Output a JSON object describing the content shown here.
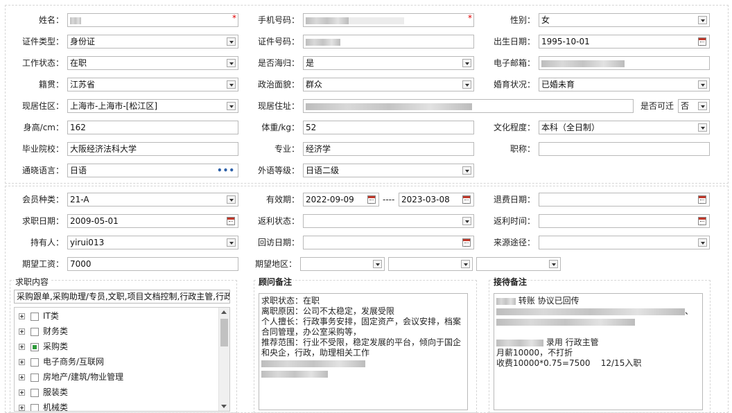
{
  "basic": {
    "name_label": "姓名：",
    "phone_label": "手机号码：",
    "gender_label": "性别：",
    "gender_value": "女",
    "id_type_label": "证件类型：",
    "id_type_value": "身份证",
    "id_no_label": "证件号码：",
    "birth_label": "出生日期：",
    "birth_value": "1995-10-01",
    "work_status_label": "工作状态：",
    "work_status_value": "在职",
    "returnee_label": "是否海归：",
    "returnee_value": "是",
    "email_label": "电子邮箱：",
    "native_label": "籍贯：",
    "native_value": "江苏省",
    "political_label": "政治面貌：",
    "political_value": "群众",
    "marital_label": "婚育状况：",
    "marital_value": "已婚未育",
    "area_label": "现居住区：",
    "area_value": "上海市-上海市-[松江区]",
    "address_label": "现居住址：",
    "relocate_label": "是否可迁",
    "relocate_value": "否",
    "height_label": "身高/cm：",
    "height_value": "162",
    "weight_label": "体重/kg：",
    "weight_value": "52",
    "education_label": "文化程度：",
    "education_value": "本科（全日制）",
    "school_label": "毕业院校：",
    "school_value": "大阪经济法科大学",
    "major_label": "专业：",
    "major_value": "经济学",
    "title_label": "职称：",
    "language_label": "通晓语言：",
    "language_value": "日语",
    "language_more": "•••",
    "lang_level_label": "外语等级：",
    "lang_level_value": "日语二级",
    "required_mark": "*"
  },
  "member": {
    "type_label": "会员种类：",
    "type_value": "21-A",
    "valid_label": "有效期：",
    "valid_from": "2022-09-09",
    "valid_sep": "----",
    "valid_to": "2023-03-08",
    "refund_label": "退费日期：",
    "apply_label": "求职日期：",
    "apply_value": "2009-05-01",
    "rebate_status_label": "返利状态：",
    "rebate_time_label": "返利时间：",
    "holder_label": "持有人：",
    "holder_value": "yirui013",
    "visit_label": "回访日期：",
    "source_label": "来源途径：",
    "salary_label": "期望工资：",
    "salary_value": "7000",
    "region_label": "期望地区："
  },
  "job_content": {
    "title": "求职内容",
    "summary": "采购跟单,采购助理/专员,文职,项目文档控制,行政主管,行政",
    "tree": [
      "IT类",
      "财务类",
      "采购类",
      "电子商务/互联网",
      "房地产/建筑/物业管理",
      "服装类",
      "机械类"
    ]
  },
  "consultant": {
    "title": "顾问备注",
    "lines": [
      "求职状态：在职",
      "离职原因：公司不太稳定，发展受限",
      "个人擅长：行政事务安排，固定资产，会议安排，档案",
      "合同管理，办公室采购等，",
      "推荐范围：行业不受限，稳定发展的平台，倾向于国企",
      "和央企，行政，助理相关工作"
    ]
  },
  "reception": {
    "title": "接待备注",
    "line1": "转账 协议已回传",
    "line1_suffix": "、",
    "line2": "录用 行政主管",
    "line3": "月薪10000，不打折",
    "line4": "收费10000*0.75=7500    12/15入职"
  },
  "icons": {
    "select": "chevron-down-icon",
    "calendar": "calendar-icon",
    "expand": "plus-box-icon"
  },
  "colors": {
    "required": "#e00000",
    "checkbox_partial": "#2e9a3a",
    "calendar_accent": "#c0392b",
    "more_dots": "#2b5fa8"
  }
}
